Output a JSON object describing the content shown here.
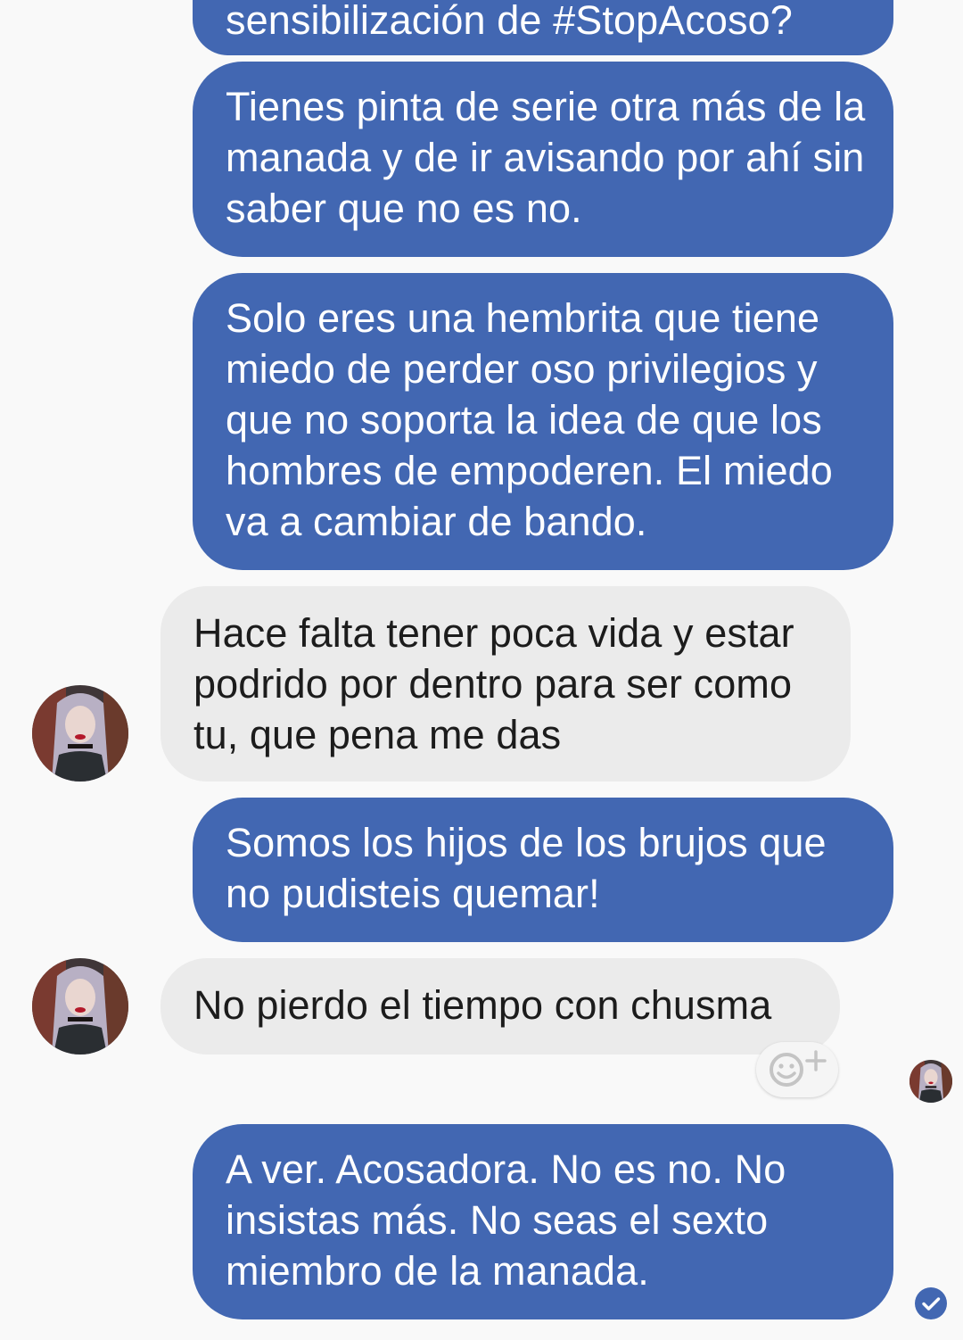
{
  "messages": [
    {
      "sender": "me",
      "text": "sensibilización de #StopAcoso?"
    },
    {
      "sender": "me",
      "text": "Tienes pinta de serie otra más de la manada y de ir avisando por ahí sin saber que no es no."
    },
    {
      "sender": "me",
      "text": "Solo eres una hembrita que tiene miedo de perder oso privilegios y que no soporta la idea de que los hombres de empoderen. El miedo va a cambiar de bando."
    },
    {
      "sender": "them",
      "text": "Hace falta tener poca vida y estar podrido por dentro para ser como tu, que pena me das"
    },
    {
      "sender": "me",
      "text": "Somos los hijos de los brujos que no pudisteis quemar!"
    },
    {
      "sender": "them",
      "text": "No pierdo el tiempo con chusma"
    },
    {
      "sender": "me",
      "text": "A ver. Acosadora. No es no. No insistas más. No seas el sexto miembro de la manada."
    }
  ],
  "icons": {
    "reaction": "add-reaction-icon",
    "seen": "check-circle-icon",
    "avatar": "contact-avatar"
  },
  "colors": {
    "outgoing_bubble": "#4267b2",
    "incoming_bubble": "#ebebeb",
    "background": "#f9f9f9",
    "seen_check": "#4267b2"
  }
}
